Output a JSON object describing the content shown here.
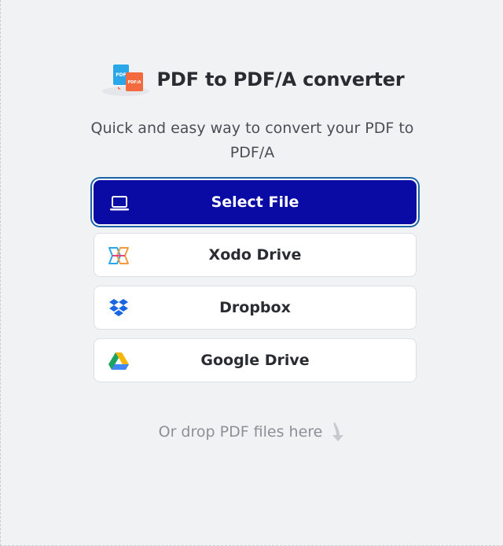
{
  "header": {
    "logo_icon": "pdf-to-pdfa-logo-icon",
    "logo_badge_left": "PDF",
    "logo_badge_right": "PDF/A",
    "title": "PDF to PDF/A converter"
  },
  "subtitle": "Quick and easy way to convert your PDF to PDF/A",
  "buttons": [
    {
      "label": "Select File",
      "icon": "laptop-icon"
    },
    {
      "label": "Xodo Drive",
      "icon": "xodo-logo-icon"
    },
    {
      "label": "Dropbox",
      "icon": "dropbox-logo-icon"
    },
    {
      "label": "Google Drive",
      "icon": "google-drive-logo-icon"
    }
  ],
  "drop_hint": {
    "text": "Or drop PDF files here",
    "icon": "arrow-down-icon"
  },
  "colors": {
    "background": "#f1f2f4",
    "primary_button": "#0a0aa4",
    "focus_ring": "#1b63a8",
    "pdf_badge": "#2aa7e8",
    "pdfa_badge": "#f26a3d",
    "hint_text": "#8b8f96"
  }
}
